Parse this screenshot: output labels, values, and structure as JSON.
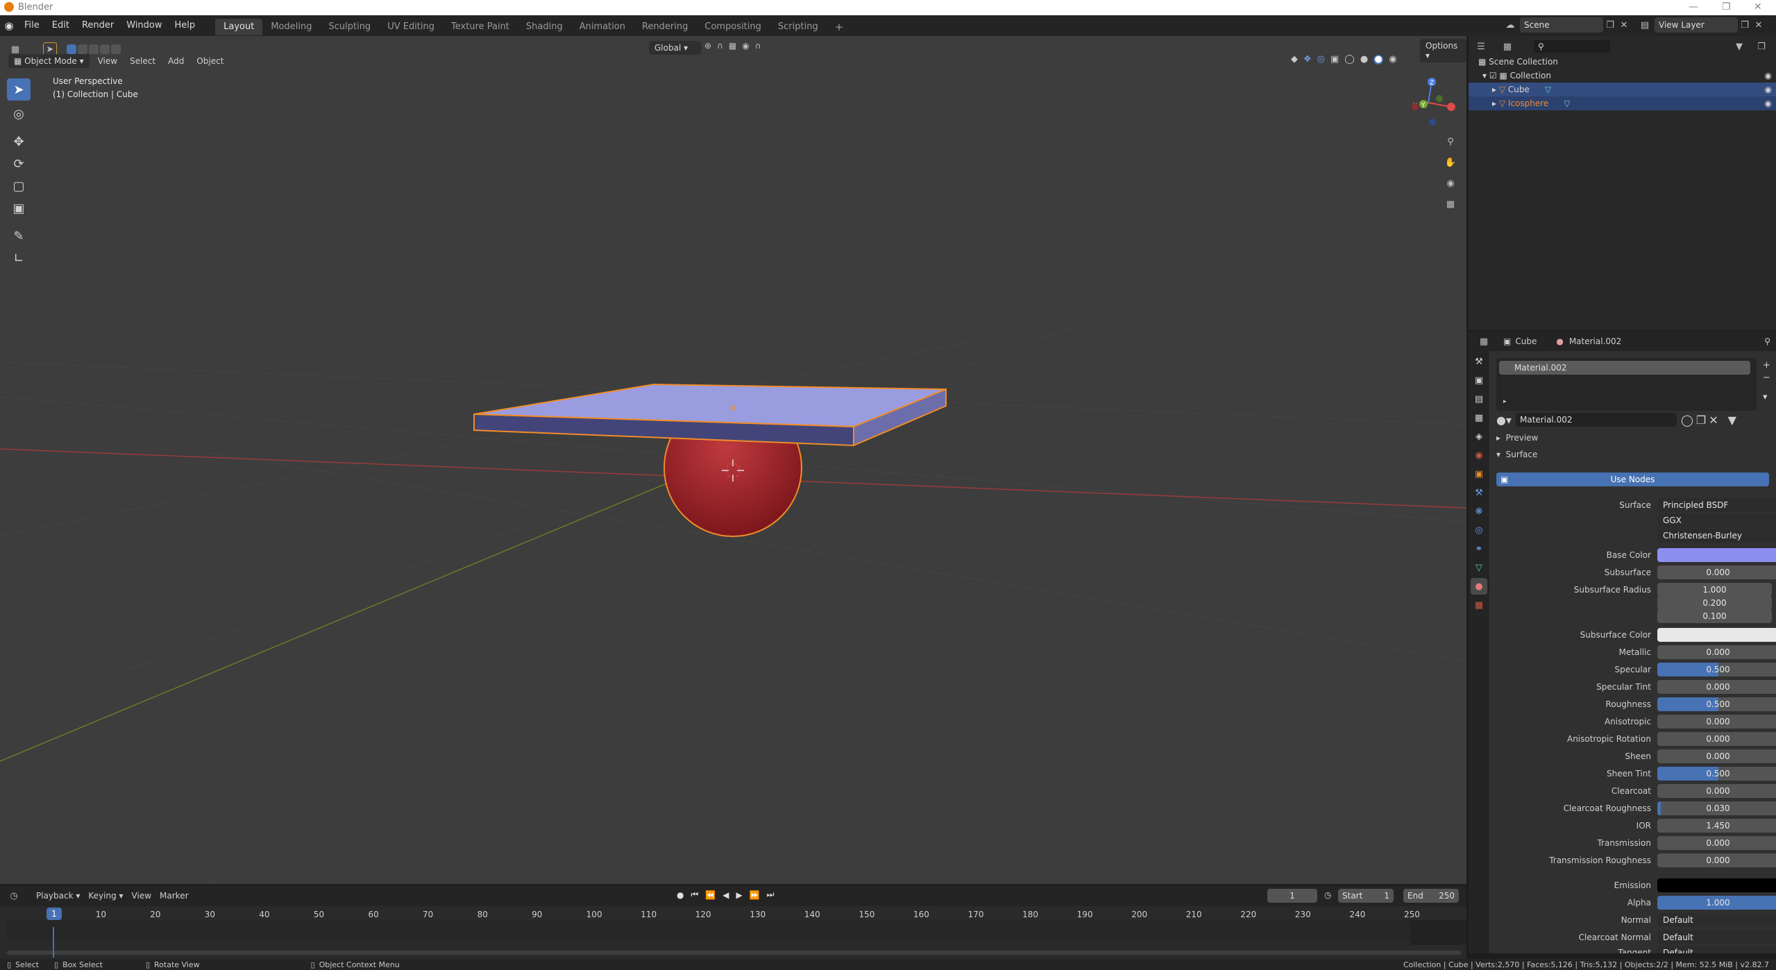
{
  "window": {
    "title": "Blender"
  },
  "menubar": {
    "items": [
      "File",
      "Edit",
      "Render",
      "Window",
      "Help"
    ]
  },
  "workspaces": [
    "Layout",
    "Modeling",
    "Sculpting",
    "UV Editing",
    "Texture Paint",
    "Shading",
    "Animation",
    "Rendering",
    "Compositing",
    "Scripting"
  ],
  "scene": {
    "name": "Scene",
    "view_layer": "View Layer"
  },
  "viewport": {
    "mode": "Object Mode",
    "menus": [
      "View",
      "Select",
      "Add",
      "Object"
    ],
    "orientation": "Global",
    "options_label": "Options",
    "perspective_label": "User Perspective",
    "collection_label": "(1) Collection | Cube",
    "gizmo": {
      "z": "Z",
      "y": "Y",
      "x": "X"
    }
  },
  "outliner": {
    "root": "Scene Collection",
    "collection": "Collection",
    "objects": [
      "Cube",
      "Icosphere"
    ]
  },
  "properties": {
    "breadcrumb_object": "Cube",
    "breadcrumb_material": "Material.002",
    "slot_name": "Material.002",
    "material_name": "Material.002",
    "preview_label": "Preview",
    "surface_panel_label": "Surface",
    "use_nodes_label": "Use Nodes",
    "surface_label": "Surface",
    "surface_value": "Principled BSDF",
    "distribution": "GGX",
    "subsurface_method": "Christensen-Burley",
    "base_color_label": "Base Color",
    "base_color": "#8d8ff0",
    "subsurface_label": "Subsurface",
    "subsurface_value": "0.000",
    "radius_label": "Subsurface Radius",
    "radius": [
      "1.000",
      "0.200",
      "0.100"
    ],
    "subsurface_color_label": "Subsurface Color",
    "subsurface_color": "#e8e8e8",
    "params": [
      {
        "label": "Metallic",
        "value": "0.000",
        "fill": 0
      },
      {
        "label": "Specular",
        "value": "0.500",
        "fill": 0.5
      },
      {
        "label": "Specular Tint",
        "value": "0.000",
        "fill": 0
      },
      {
        "label": "Roughness",
        "value": "0.500",
        "fill": 0.5
      },
      {
        "label": "Anisotropic",
        "value": "0.000",
        "fill": 0
      },
      {
        "label": "Anisotropic Rotation",
        "value": "0.000",
        "fill": 0
      },
      {
        "label": "Sheen",
        "value": "0.000",
        "fill": 0
      },
      {
        "label": "Sheen Tint",
        "value": "0.500",
        "fill": 0.5
      },
      {
        "label": "Clearcoat",
        "value": "0.000",
        "fill": 0
      },
      {
        "label": "Clearcoat Roughness",
        "value": "0.030",
        "fill": 0.03
      },
      {
        "label": "IOR",
        "value": "1.450",
        "fill": 0
      },
      {
        "label": "Transmission",
        "value": "0.000",
        "fill": 0
      },
      {
        "label": "Transmission Roughness",
        "value": "0.000",
        "fill": 0
      }
    ],
    "emission_label": "Emission",
    "emission_color": "#000000",
    "alpha_label": "Alpha",
    "alpha_value": "1.000",
    "alpha_fill": 1,
    "normal_label": "Normal",
    "normal_value": "Default",
    "clearcoat_normal_label": "Clearcoat Normal",
    "clearcoat_normal_value": "Default",
    "tangent_label": "Tangent",
    "tangent_value": "Default"
  },
  "timeline": {
    "menus": [
      "Playback",
      "Keying",
      "View",
      "Marker"
    ],
    "current_frame": "1",
    "start_label": "Start",
    "start": "1",
    "end_label": "End",
    "end": "250",
    "ticks": [
      "1",
      "10",
      "20",
      "30",
      "40",
      "50",
      "60",
      "70",
      "80",
      "90",
      "100",
      "110",
      "120",
      "130",
      "140",
      "150",
      "160",
      "170",
      "180",
      "190",
      "200",
      "210",
      "220",
      "230",
      "240",
      "250"
    ]
  },
  "statusbar": {
    "select": "Select",
    "box_select": "Box Select",
    "rotate_view": "Rotate View",
    "context_menu": "Object Context Menu",
    "stats": "Collection | Cube | Verts:2,570 | Faces:5,126 | Tris:5,132 | Objects:2/2 | Mem: 52.5 MiB | v2.82.7"
  },
  "colors": {
    "accent": "#4772b3",
    "selection_orange": "#f28c28",
    "cube_top": "#9a9ce0",
    "sphere": "#a8262c"
  }
}
